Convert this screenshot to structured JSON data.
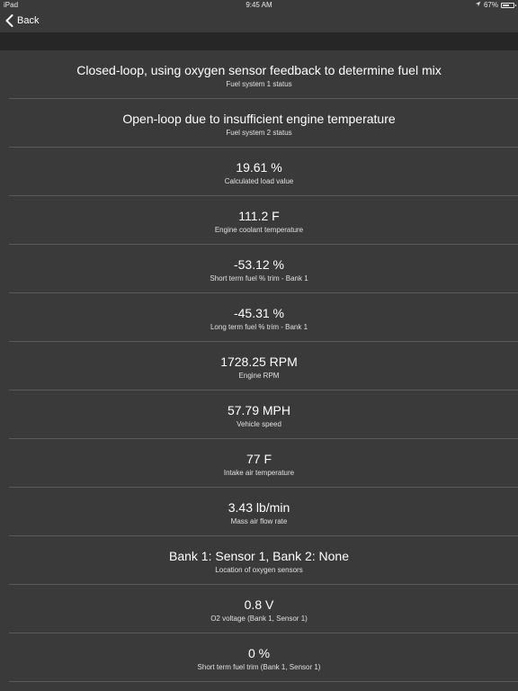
{
  "status_bar": {
    "device": "iPad",
    "time": "9:45 AM",
    "battery_text": "67%",
    "battery_level": 0.67
  },
  "nav": {
    "back_label": "Back"
  },
  "items": [
    {
      "value": "Closed-loop, using oxygen sensor feedback to determine fuel mix",
      "label": "Fuel system 1 status"
    },
    {
      "value": "Open-loop due to insufficient engine temperature",
      "label": "Fuel system 2 status"
    },
    {
      "value": "19.61 %",
      "label": "Calculated load value"
    },
    {
      "value": "111.2 F",
      "label": "Engine coolant temperature"
    },
    {
      "value": "-53.12 %",
      "label": "Short term fuel % trim - Bank 1"
    },
    {
      "value": "-45.31 %",
      "label": "Long term fuel % trim - Bank 1"
    },
    {
      "value": "1728.25 RPM",
      "label": "Engine RPM"
    },
    {
      "value": "57.79 MPH",
      "label": "Vehicle speed"
    },
    {
      "value": "77 F",
      "label": "Intake air temperature"
    },
    {
      "value": "3.43 lb/min",
      "label": "Mass air flow rate"
    },
    {
      "value": "Bank 1: Sensor 1, Bank 2: None",
      "label": "Location of oxygen sensors"
    },
    {
      "value": "0.8 V",
      "label": "O2 voltage (Bank 1, Sensor 1)"
    },
    {
      "value": "0 %",
      "label": "Short term fuel trim (Bank 1, Sensor 1)"
    }
  ]
}
